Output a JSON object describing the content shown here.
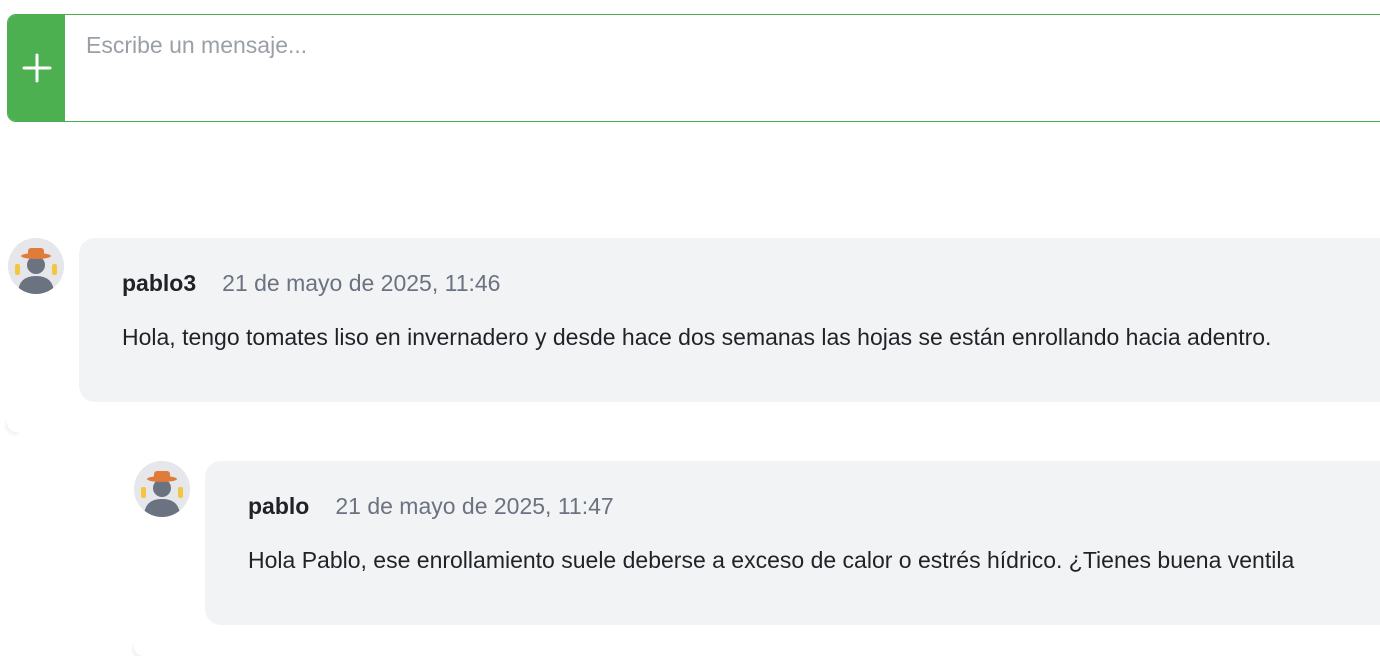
{
  "composer": {
    "placeholder": "Escribe un mensaje..."
  },
  "comments": [
    {
      "author": "pablo3",
      "date": "21 de mayo de 2025, 11:46",
      "text": "Hola, tengo tomates liso en invernadero y desde hace dos semanas las hojas se están enrollando hacia adentro."
    },
    {
      "author": "pablo",
      "date": "21 de mayo de 2025, 11:47",
      "text": "Hola Pablo, ese enrollamiento suele deberse a exceso de calor o estrés hídrico. ¿Tienes buena ventila"
    }
  ],
  "colors": {
    "accent": "#4caf50",
    "bubble": "#f2f3f5",
    "date": "#6b7280"
  },
  "icons": {
    "add": "plus-icon",
    "avatar": "farmer-avatar-icon"
  }
}
